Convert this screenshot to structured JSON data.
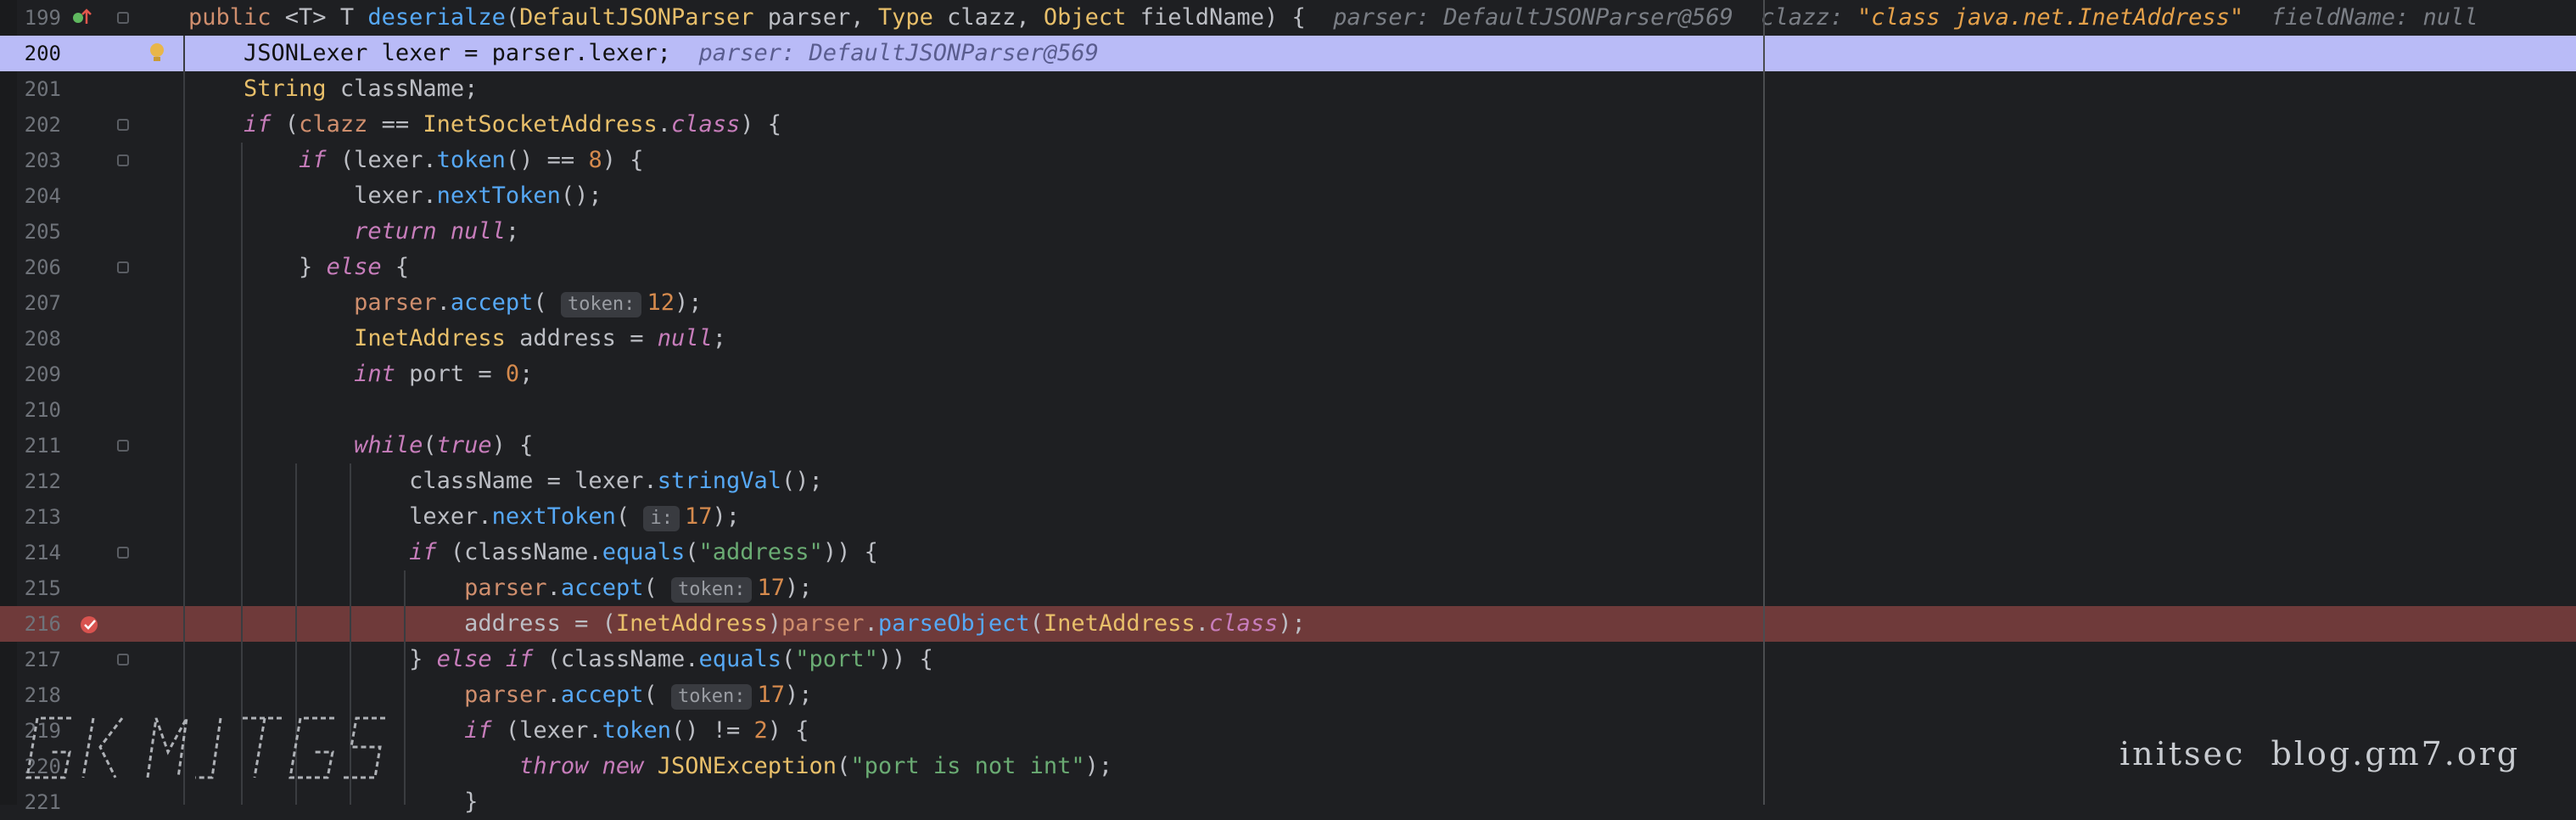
{
  "watermark": {
    "left_logo_text": "GKMJTGS",
    "right_text": "initsec  blog.gm7.org"
  },
  "lines": [
    {
      "num": "199",
      "state": "normal",
      "tokens": [
        {
          "c": "kw",
          "t": "public "
        },
        {
          "c": "",
          "t": "<T> T "
        },
        {
          "c": "fn",
          "t": "deserialze"
        },
        {
          "c": "",
          "t": "("
        },
        {
          "c": "typ",
          "t": "DefaultJSONParser"
        },
        {
          "c": "",
          "t": " parser, "
        },
        {
          "c": "typ",
          "t": "Type"
        },
        {
          "c": "",
          "t": " clazz, "
        },
        {
          "c": "typ",
          "t": "Object"
        },
        {
          "c": "",
          "t": " fieldName) {  "
        },
        {
          "c": "inl",
          "t": "parser: DefaultJSONParser@569  clazz: "
        },
        {
          "c": "inlv",
          "t": "\"class java.net.InetAddress\""
        },
        {
          "c": "inl",
          "t": "  fieldName: null"
        }
      ]
    },
    {
      "num": "200",
      "state": "current",
      "tokens": [
        {
          "c": "",
          "t": "    JSONLexer lexer = parser.lexer;  "
        },
        {
          "c": "inl",
          "t": "parser: DefaultJSONParser@569"
        }
      ]
    },
    {
      "num": "201",
      "state": "normal",
      "tokens": [
        {
          "c": "",
          "t": "    "
        },
        {
          "c": "typ",
          "t": "String"
        },
        {
          "c": "",
          "t": " className;"
        }
      ]
    },
    {
      "num": "202",
      "state": "normal",
      "tokens": [
        {
          "c": "",
          "t": "    "
        },
        {
          "c": "kwi",
          "t": "if"
        },
        {
          "c": "",
          "t": " ("
        },
        {
          "c": "kw",
          "t": "clazz"
        },
        {
          "c": "",
          "t": " == "
        },
        {
          "c": "typ",
          "t": "InetSocketAddress"
        },
        {
          "c": "",
          "t": "."
        },
        {
          "c": "kwi",
          "t": "class"
        },
        {
          "c": "",
          "t": ") {"
        }
      ]
    },
    {
      "num": "203",
      "state": "normal",
      "tokens": [
        {
          "c": "",
          "t": "        "
        },
        {
          "c": "kwi",
          "t": "if"
        },
        {
          "c": "",
          "t": " (lexer."
        },
        {
          "c": "fn",
          "t": "token"
        },
        {
          "c": "",
          "t": "() == "
        },
        {
          "c": "num",
          "t": "8"
        },
        {
          "c": "",
          "t": ") {"
        }
      ]
    },
    {
      "num": "204",
      "state": "normal",
      "tokens": [
        {
          "c": "",
          "t": "            lexer."
        },
        {
          "c": "fn",
          "t": "nextToken"
        },
        {
          "c": "",
          "t": "();"
        }
      ]
    },
    {
      "num": "205",
      "state": "normal",
      "tokens": [
        {
          "c": "",
          "t": "            "
        },
        {
          "c": "kwi",
          "t": "return"
        },
        {
          "c": "",
          "t": " "
        },
        {
          "c": "kwi",
          "t": "null"
        },
        {
          "c": "",
          "t": ";"
        }
      ]
    },
    {
      "num": "206",
      "state": "normal",
      "tokens": [
        {
          "c": "",
          "t": "        } "
        },
        {
          "c": "kwi",
          "t": "else"
        },
        {
          "c": "",
          "t": " {"
        }
      ]
    },
    {
      "num": "207",
      "state": "normal",
      "tokens": [
        {
          "c": "",
          "t": "            "
        },
        {
          "c": "kw",
          "t": "parser"
        },
        {
          "c": "",
          "t": "."
        },
        {
          "c": "fn",
          "t": "accept"
        },
        {
          "c": "",
          "t": "( "
        },
        {
          "c": "hint",
          "t": "token:"
        },
        {
          "c": "num",
          "t": "12"
        },
        {
          "c": "",
          "t": ");"
        }
      ]
    },
    {
      "num": "208",
      "state": "normal",
      "tokens": [
        {
          "c": "",
          "t": "            "
        },
        {
          "c": "typ",
          "t": "InetAddress"
        },
        {
          "c": "",
          "t": " address = "
        },
        {
          "c": "kwi",
          "t": "null"
        },
        {
          "c": "",
          "t": ";"
        }
      ]
    },
    {
      "num": "209",
      "state": "normal",
      "tokens": [
        {
          "c": "",
          "t": "            "
        },
        {
          "c": "kwi",
          "t": "int"
        },
        {
          "c": "",
          "t": " port = "
        },
        {
          "c": "num",
          "t": "0"
        },
        {
          "c": "",
          "t": ";"
        }
      ]
    },
    {
      "num": "210",
      "state": "normal",
      "tokens": [
        {
          "c": "",
          "t": ""
        }
      ]
    },
    {
      "num": "211",
      "state": "normal",
      "tokens": [
        {
          "c": "",
          "t": "            "
        },
        {
          "c": "kwi",
          "t": "while"
        },
        {
          "c": "",
          "t": "("
        },
        {
          "c": "kwi",
          "t": "true"
        },
        {
          "c": "",
          "t": ") {"
        }
      ]
    },
    {
      "num": "212",
      "state": "normal",
      "tokens": [
        {
          "c": "",
          "t": "                className = lexer."
        },
        {
          "c": "fn",
          "t": "stringVal"
        },
        {
          "c": "",
          "t": "();"
        }
      ]
    },
    {
      "num": "213",
      "state": "normal",
      "tokens": [
        {
          "c": "",
          "t": "                lexer."
        },
        {
          "c": "fn",
          "t": "nextToken"
        },
        {
          "c": "",
          "t": "( "
        },
        {
          "c": "hint",
          "t": "i:"
        },
        {
          "c": "num",
          "t": "17"
        },
        {
          "c": "",
          "t": ");"
        }
      ]
    },
    {
      "num": "214",
      "state": "normal",
      "tokens": [
        {
          "c": "",
          "t": "                "
        },
        {
          "c": "kwi",
          "t": "if"
        },
        {
          "c": "",
          "t": " (className."
        },
        {
          "c": "fn",
          "t": "equals"
        },
        {
          "c": "",
          "t": "("
        },
        {
          "c": "str",
          "t": "\"address\""
        },
        {
          "c": "",
          "t": ")) {"
        }
      ]
    },
    {
      "num": "215",
      "state": "normal",
      "tokens": [
        {
          "c": "",
          "t": "                    "
        },
        {
          "c": "kw",
          "t": "parser"
        },
        {
          "c": "",
          "t": "."
        },
        {
          "c": "fn",
          "t": "accept"
        },
        {
          "c": "",
          "t": "( "
        },
        {
          "c": "hint",
          "t": "token:"
        },
        {
          "c": "num",
          "t": "17"
        },
        {
          "c": "",
          "t": ");"
        }
      ]
    },
    {
      "num": "216",
      "state": "breakpoint",
      "tokens": [
        {
          "c": "",
          "t": "                    address = ("
        },
        {
          "c": "typ",
          "t": "InetAddress"
        },
        {
          "c": "",
          "t": ")"
        },
        {
          "c": "kw",
          "t": "parser"
        },
        {
          "c": "",
          "t": "."
        },
        {
          "c": "fn",
          "t": "parseObject"
        },
        {
          "c": "",
          "t": "("
        },
        {
          "c": "typ",
          "t": "InetAddress"
        },
        {
          "c": "",
          "t": "."
        },
        {
          "c": "kwi",
          "t": "class"
        },
        {
          "c": "",
          "t": ");"
        }
      ]
    },
    {
      "num": "217",
      "state": "normal",
      "tokens": [
        {
          "c": "",
          "t": "                } "
        },
        {
          "c": "kwi",
          "t": "else if"
        },
        {
          "c": "",
          "t": " (className."
        },
        {
          "c": "fn",
          "t": "equals"
        },
        {
          "c": "",
          "t": "("
        },
        {
          "c": "str",
          "t": "\"port\""
        },
        {
          "c": "",
          "t": ")) {"
        }
      ]
    },
    {
      "num": "218",
      "state": "normal",
      "tokens": [
        {
          "c": "",
          "t": "                    "
        },
        {
          "c": "kw",
          "t": "parser"
        },
        {
          "c": "",
          "t": "."
        },
        {
          "c": "fn",
          "t": "accept"
        },
        {
          "c": "",
          "t": "( "
        },
        {
          "c": "hint",
          "t": "token:"
        },
        {
          "c": "num",
          "t": "17"
        },
        {
          "c": "",
          "t": ");"
        }
      ]
    },
    {
      "num": "219",
      "state": "normal",
      "tokens": [
        {
          "c": "",
          "t": "                    "
        },
        {
          "c": "kwi",
          "t": "if"
        },
        {
          "c": "",
          "t": " (lexer."
        },
        {
          "c": "fn",
          "t": "token"
        },
        {
          "c": "",
          "t": "() != "
        },
        {
          "c": "num",
          "t": "2"
        },
        {
          "c": "",
          "t": ") {"
        }
      ]
    },
    {
      "num": "220",
      "state": "normal",
      "tokens": [
        {
          "c": "",
          "t": "                        "
        },
        {
          "c": "kwi",
          "t": "throw new"
        },
        {
          "c": "",
          "t": " "
        },
        {
          "c": "typ",
          "t": "JSONException"
        },
        {
          "c": "",
          "t": "("
        },
        {
          "c": "str",
          "t": "\"port is not int\""
        },
        {
          "c": "",
          "t": ");"
        }
      ]
    },
    {
      "num": "221",
      "state": "normal",
      "tokens": [
        {
          "c": "",
          "t": "                    }"
        }
      ]
    }
  ]
}
